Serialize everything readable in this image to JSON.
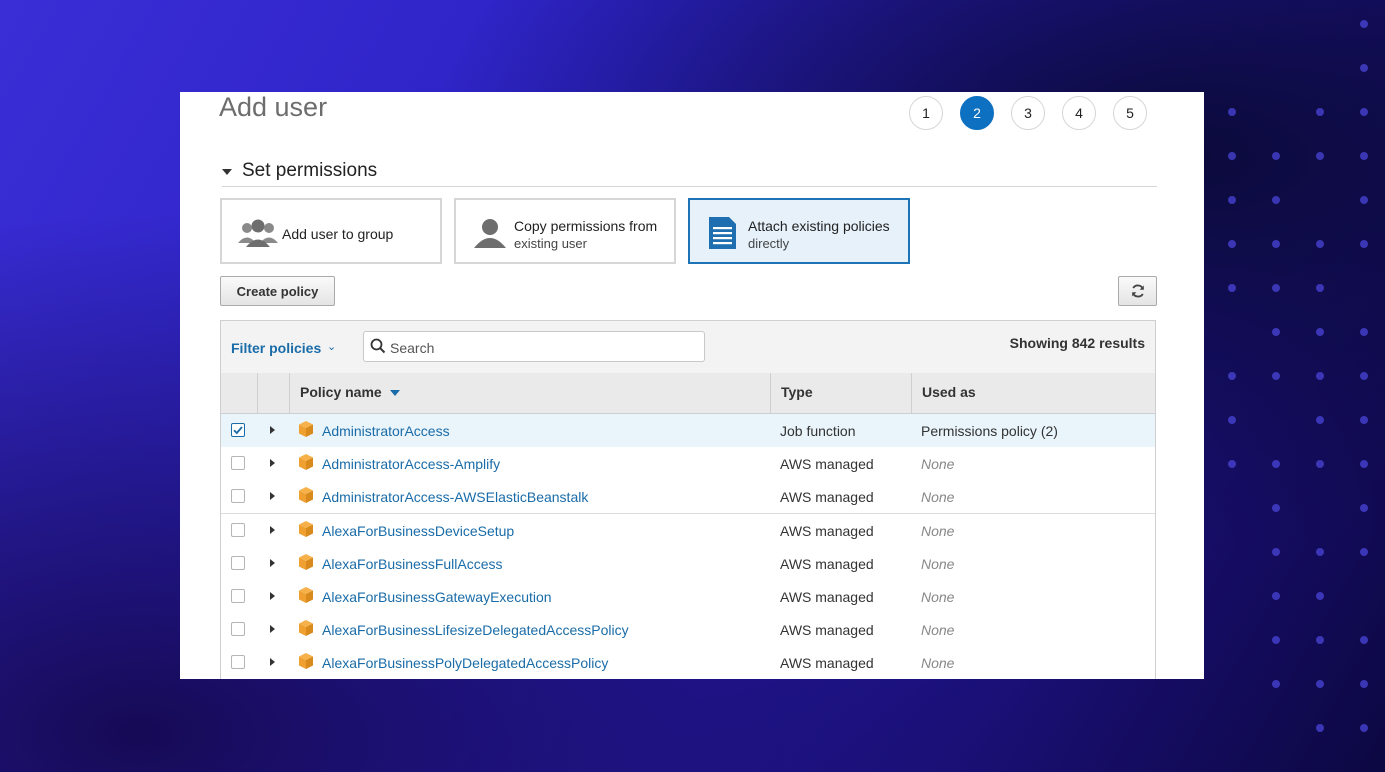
{
  "page": {
    "title": "Add user",
    "steps": [
      "1",
      "2",
      "3",
      "4",
      "5"
    ],
    "active_step": "2"
  },
  "section": {
    "label": "Set permissions"
  },
  "options": [
    {
      "line1": "Add user to group",
      "line2": "",
      "icon": "users-group-icon",
      "selected": false
    },
    {
      "line1": "Copy permissions from",
      "line2": "existing user",
      "icon": "user-icon",
      "selected": false
    },
    {
      "line1": "Attach existing policies",
      "line2": "directly",
      "icon": "document-icon",
      "selected": true
    }
  ],
  "toolbar": {
    "create_policy_label": "Create policy",
    "refresh_icon": "refresh-icon"
  },
  "filter": {
    "label": "Filter policies",
    "search_placeholder": "Search",
    "results_text": "Showing 842 results"
  },
  "table": {
    "columns": {
      "name": "Policy name",
      "type": "Type",
      "used_as": "Used as"
    },
    "rows": [
      {
        "name": "AdministratorAccess",
        "type": "Job function",
        "used_as": "Permissions policy (2)",
        "checked": true
      },
      {
        "name": "AdministratorAccess-Amplify",
        "type": "AWS managed",
        "used_as": "None",
        "checked": false
      },
      {
        "name": "AdministratorAccess-AWSElasticBeanstalk",
        "type": "AWS managed",
        "used_as": "None",
        "checked": false
      },
      {
        "name": "AlexaForBusinessDeviceSetup",
        "type": "AWS managed",
        "used_as": "None",
        "checked": false
      },
      {
        "name": "AlexaForBusinessFullAccess",
        "type": "AWS managed",
        "used_as": "None",
        "checked": false
      },
      {
        "name": "AlexaForBusinessGatewayExecution",
        "type": "AWS managed",
        "used_as": "None",
        "checked": false
      },
      {
        "name": "AlexaForBusinessLifesizeDelegatedAccessPolicy",
        "type": "AWS managed",
        "used_as": "None",
        "checked": false
      },
      {
        "name": "AlexaForBusinessPolyDelegatedAccessPolicy",
        "type": "AWS managed",
        "used_as": "None",
        "checked": false
      }
    ]
  },
  "colors": {
    "accent": "#0d70c0",
    "link": "#1a6ca8",
    "package_icon": "#f0a030"
  }
}
